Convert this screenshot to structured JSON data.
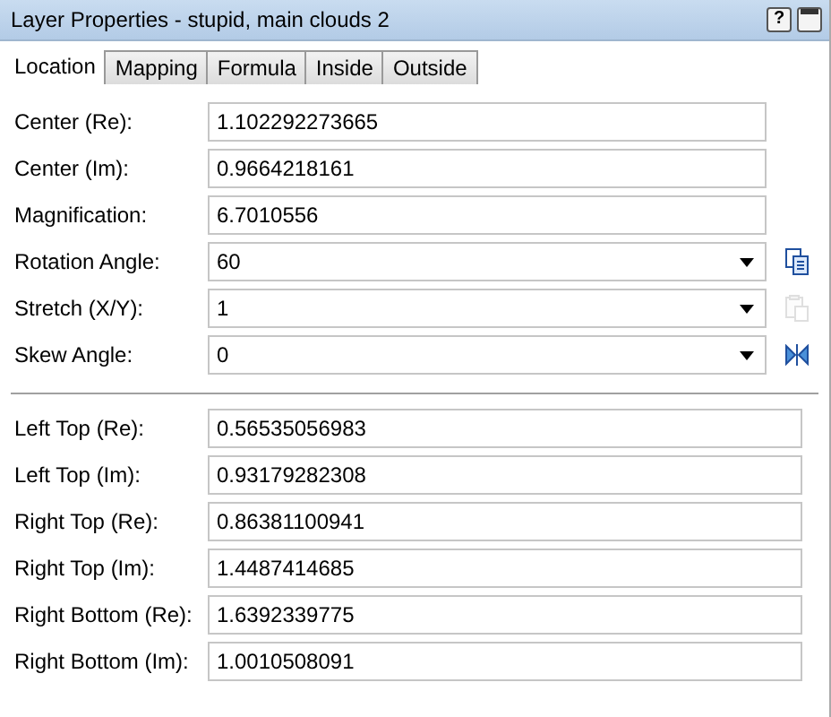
{
  "window": {
    "title": "Layer Properties - stupid, main clouds 2",
    "buttons": [
      {
        "label": "?"
      }
    ]
  },
  "tabs": [
    {
      "label": "Location",
      "selected": true
    },
    {
      "label": "Mapping",
      "selected": false
    },
    {
      "label": "Formula",
      "selected": false
    },
    {
      "label": "Inside",
      "selected": false
    },
    {
      "label": "Outside",
      "selected": false
    }
  ],
  "top_fields": [
    {
      "label": "Center (Re):",
      "value": "1.102292273665",
      "kind": "text"
    },
    {
      "label": "Center (Im):",
      "value": "0.9664218161",
      "kind": "text"
    },
    {
      "label": "Magnification:",
      "value": "6.7010556",
      "kind": "text"
    },
    {
      "label": "Rotation Angle:",
      "value": "60",
      "kind": "combo",
      "action": {
        "kind": "copy",
        "disabled": false
      }
    },
    {
      "label": "Stretch (X/Y):",
      "value": "1",
      "kind": "combo",
      "action": {
        "kind": "paste",
        "disabled": true
      }
    },
    {
      "label": "Skew Angle:",
      "value": "0",
      "kind": "combo",
      "action": {
        "kind": "flip",
        "disabled": false
      }
    }
  ],
  "corner_fields": [
    {
      "label": "Left Top (Re):",
      "value": "0.56535056983"
    },
    {
      "label": "Left Top (Im):",
      "value": "0.93179282308"
    },
    {
      "label": "Right Top (Re):",
      "value": "0.86381100941"
    },
    {
      "label": "Right Top (Im):",
      "value": "1.4487414685"
    },
    {
      "label": "Right Bottom (Re):",
      "value": "1.6392339775"
    },
    {
      "label": "Right Bottom (Im):",
      "value": "1.0010508091"
    }
  ]
}
